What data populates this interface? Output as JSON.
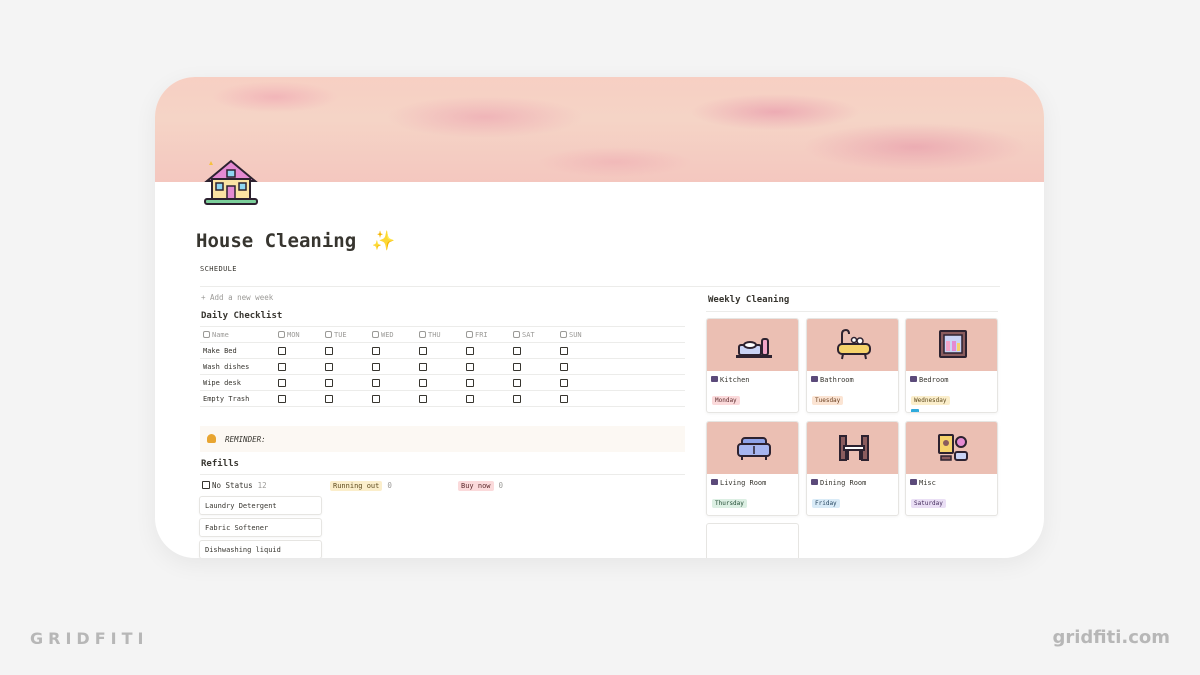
{
  "page": {
    "title": "House Cleaning",
    "title_emoji": "✨",
    "subtitle": "SCHEDULE",
    "add_week": "+ Add a new week"
  },
  "daily_checklist": {
    "heading": "Daily Checklist",
    "columns": [
      "Name",
      "MON",
      "TUE",
      "WED",
      "THU",
      "FRI",
      "SAT",
      "SUN"
    ],
    "rows": [
      {
        "name": "Make Bed",
        "checks": [
          false,
          false,
          false,
          false,
          false,
          false,
          false
        ]
      },
      {
        "name": "Wash dishes",
        "checks": [
          false,
          false,
          false,
          false,
          false,
          false,
          false
        ]
      },
      {
        "name": "Wipe desk",
        "checks": [
          false,
          false,
          false,
          false,
          false,
          false,
          false
        ]
      },
      {
        "name": "Empty Trash",
        "checks": [
          false,
          false,
          false,
          false,
          false,
          false,
          false
        ]
      }
    ]
  },
  "reminder": {
    "label": "REMINDER:"
  },
  "refills": {
    "heading": "Refills",
    "groups": [
      {
        "label": "No Status",
        "count": "12"
      },
      {
        "label": "Running out",
        "count": "0"
      },
      {
        "label": "Buy now",
        "count": "0"
      }
    ],
    "items": [
      "Laundry Detergent",
      "Fabric Softener",
      "Dishwashing liquid"
    ]
  },
  "weekly_cleaning": {
    "heading": "Weekly Cleaning",
    "rooms": [
      {
        "name": "Kitchen",
        "day": "Monday",
        "icon": "kitchen-icon",
        "color": "red",
        "checked": false
      },
      {
        "name": "Bathroom",
        "day": "Tuesday",
        "icon": "bathtub-icon",
        "color": "orange",
        "checked": false
      },
      {
        "name": "Bedroom",
        "day": "Wednesday",
        "icon": "wardrobe-icon",
        "color": "yellow",
        "checked": true
      },
      {
        "name": "Living Room",
        "day": "Thursday",
        "icon": "sofa-icon",
        "color": "green",
        "checked": false
      },
      {
        "name": "Dining Room",
        "day": "Friday",
        "icon": "dining-table-icon",
        "color": "blue",
        "checked": false
      },
      {
        "name": "Misc",
        "day": "Saturday",
        "icon": "misc-icon",
        "color": "purple",
        "checked": false
      }
    ]
  },
  "branding": {
    "left": "GRIDFITI",
    "right": "gridfiti.com"
  },
  "colors": {
    "cover": "#f5d4c6",
    "card_image": "#ebbfb3",
    "checkbox_checked": "#2eaadc"
  }
}
